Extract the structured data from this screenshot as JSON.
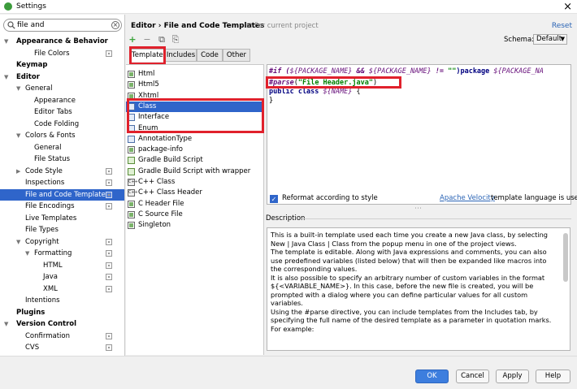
{
  "window": {
    "title": "Settings",
    "close_glyph": "×"
  },
  "search": {
    "value": "file and",
    "placeholder": ""
  },
  "sidebar": {
    "items": [
      {
        "label": "Appearance & Behavior",
        "indent": 0,
        "bold": true,
        "arrow": "down"
      },
      {
        "label": "File Colors",
        "indent": 2,
        "proj": true
      },
      {
        "label": "Keymap",
        "indent": 0,
        "bold": true
      },
      {
        "label": "Editor",
        "indent": 0,
        "bold": true,
        "arrow": "down"
      },
      {
        "label": "General",
        "indent": 1,
        "arrow": "down"
      },
      {
        "label": "Appearance",
        "indent": 2
      },
      {
        "label": "Editor Tabs",
        "indent": 2
      },
      {
        "label": "Code Folding",
        "indent": 2
      },
      {
        "label": "Colors & Fonts",
        "indent": 1,
        "arrow": "down"
      },
      {
        "label": "General",
        "indent": 2
      },
      {
        "label": "File Status",
        "indent": 2
      },
      {
        "label": "Code Style",
        "indent": 1,
        "arrow": "right",
        "proj": true
      },
      {
        "label": "Inspections",
        "indent": 1,
        "proj": true
      },
      {
        "label": "File and Code Templates",
        "indent": 1,
        "proj": true,
        "selected": true
      },
      {
        "label": "File Encodings",
        "indent": 1,
        "proj": true
      },
      {
        "label": "Live Templates",
        "indent": 1
      },
      {
        "label": "File Types",
        "indent": 1
      },
      {
        "label": "Copyright",
        "indent": 1,
        "arrow": "down",
        "proj": true
      },
      {
        "label": "Formatting",
        "indent": 2,
        "arrow": "down",
        "proj": true
      },
      {
        "label": "HTML",
        "indent": 3,
        "proj": true
      },
      {
        "label": "Java",
        "indent": 3,
        "proj": true
      },
      {
        "label": "XML",
        "indent": 3,
        "proj": true
      },
      {
        "label": "Intentions",
        "indent": 1
      },
      {
        "label": "Plugins",
        "indent": 0,
        "bold": true
      },
      {
        "label": "Version Control",
        "indent": 0,
        "bold": true,
        "arrow": "down"
      },
      {
        "label": "Confirmation",
        "indent": 1,
        "proj": true
      },
      {
        "label": "CVS",
        "indent": 1,
        "proj": true
      }
    ]
  },
  "header": {
    "breadcrumb": "Editor › File and Code Templates",
    "for_project": "⊡ For current project",
    "reset": "Reset"
  },
  "toolbar": {
    "add": "+",
    "remove": "−",
    "copy": "⧉",
    "reset": "⎘"
  },
  "schema": {
    "label": "Schema:",
    "value": "Default"
  },
  "tabs": [
    "Templates",
    "Includes",
    "Code",
    "Other"
  ],
  "templates": [
    {
      "name": "Html",
      "icon": "j"
    },
    {
      "name": "Html5",
      "icon": "j"
    },
    {
      "name": "Xhtml",
      "icon": "j"
    },
    {
      "name": "Class",
      "icon": "c",
      "selected": true
    },
    {
      "name": "Interface",
      "icon": "c"
    },
    {
      "name": "Enum",
      "icon": "c"
    },
    {
      "name": "AnnotationType",
      "icon": "c"
    },
    {
      "name": "package-info",
      "icon": "j"
    },
    {
      "name": "Gradle Build Script",
      "icon": "g"
    },
    {
      "name": "Gradle Build Script with wrapper",
      "icon": "g"
    },
    {
      "name": "C++ Class",
      "icon": "cc"
    },
    {
      "name": "C++ Class Header",
      "icon": "cc"
    },
    {
      "name": "C Header File",
      "icon": "j"
    },
    {
      "name": "C Source File",
      "icon": "j"
    },
    {
      "name": "Singleton",
      "icon": "j"
    }
  ],
  "editor": {
    "line1_a": "#if (",
    "line1_b": "${PACKAGE_NAME}",
    "line1_c": " && ",
    "line1_d": "${PACKAGE_NAME}",
    "line1_e": " != ",
    "line1_f": "\"\"",
    "line1_g": ")package ",
    "line1_h": "${PACKAGE_NA",
    "line2_a": "#parse",
    "line2_b": "(",
    "line2_c": "\"File Header.java\"",
    "line2_d": ")",
    "line3_a": "public class ",
    "line3_b": "${NAME}",
    "line3_c": " {",
    "line4": "}"
  },
  "reformat": {
    "label": "Reformat according to style",
    "checked": true
  },
  "velocity": {
    "link": "Apache Velocity",
    "rest": " template language is used"
  },
  "description": {
    "label": "Description",
    "p1": "This is a built-in template used each time you create a new Java class, by selecting New | Java Class | Class from the popup menu in one of the project views.",
    "p2": "The template is editable. Along with Java expressions and comments, you can also use predefined variables (listed below) that will then be expanded like macros into the corresponding values.",
    "p3": "It is also possible to specify an arbitrary number of custom variables in the format ${<VARIABLE_NAME>}. In this case, before the new file is created, you will be prompted with a dialog where you can define particular values for all custom variables.",
    "p4": "Using the #parse directive, you can include templates from the Includes tab, by specifying the full name of the desired template as a parameter in quotation marks. For example:"
  },
  "buttons": {
    "ok": "OK",
    "cancel": "Cancel",
    "apply": "Apply",
    "help": "Help"
  }
}
